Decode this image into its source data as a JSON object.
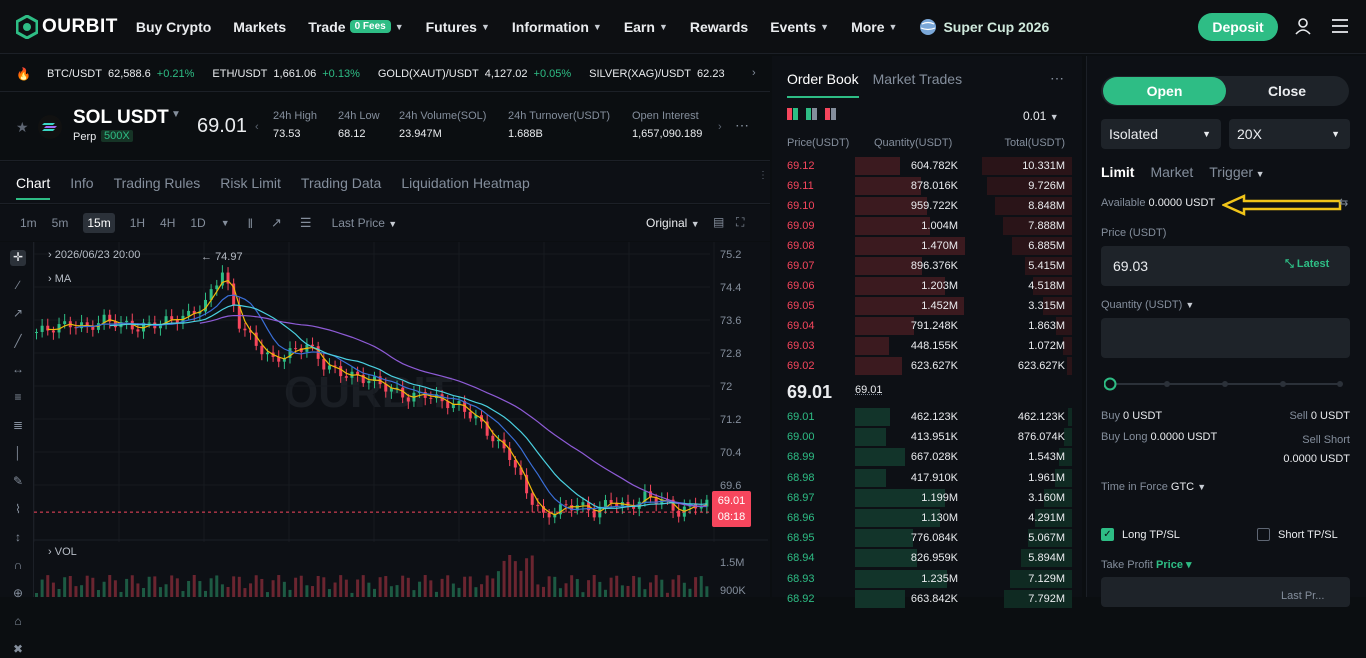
{
  "nav": {
    "logo_text": "OURBIT",
    "items": [
      {
        "label": "Buy Crypto",
        "dropdown": false
      },
      {
        "label": "Markets",
        "dropdown": false
      },
      {
        "label": "Trade",
        "badge": "0 Fees",
        "dropdown": true
      },
      {
        "label": "Futures",
        "dropdown": true
      },
      {
        "label": "Information",
        "dropdown": true
      },
      {
        "label": "Earn",
        "dropdown": true
      },
      {
        "label": "Rewards",
        "dropdown": false
      },
      {
        "label": "Events",
        "dropdown": true
      },
      {
        "label": "More",
        "dropdown": true
      }
    ],
    "super_cup": "Super Cup 2026",
    "deposit_label": "Deposit",
    "icons": [
      "user-icon",
      "menu-icon"
    ]
  },
  "ticker": [
    {
      "symbol": "BTC/USDT",
      "price": "62,588.6",
      "change": "+0.21%"
    },
    {
      "symbol": "ETH/USDT",
      "price": "1,661.06",
      "change": "+0.13%"
    },
    {
      "symbol": "GOLD(XAUT)/USDT",
      "price": "4,127.02",
      "change": "+0.05%"
    },
    {
      "symbol": "SILVER(XAG)/USDT",
      "price": "62.23",
      "change": ""
    }
  ],
  "symbol": {
    "name": "SOL USDT",
    "type": "Perp",
    "leverage": "500X",
    "price": "69.01",
    "stats": [
      {
        "label": "24h High",
        "value": "73.53"
      },
      {
        "label": "24h Low",
        "value": "68.12"
      },
      {
        "label": "24h Volume(SOL)",
        "value": "23.947M"
      },
      {
        "label": "24h Turnover(USDT)",
        "value": "1.688B"
      },
      {
        "label": "Open Interest",
        "value": "1,657,090.189"
      }
    ]
  },
  "chart_tabs": [
    "Chart",
    "Info",
    "Trading Rules",
    "Risk Limit",
    "Trading Data",
    "Liquidation Heatmap"
  ],
  "intervals": [
    "1m",
    "5m",
    "15m",
    "1H",
    "4H",
    "1D"
  ],
  "active_interval": "15m",
  "price_type": "Last Price",
  "chart_mode": "Original",
  "chart": {
    "crosshair_time": "2026/06/23 20:00",
    "ma_label": "MA",
    "vol_label": "VOL",
    "high_marker": "74.97",
    "y_ticks": [
      "75.2",
      "74.4",
      "73.6",
      "72.8",
      "72",
      "71.2",
      "70.4",
      "69.6"
    ],
    "vol_ticks": [
      "1.5M",
      "900K"
    ],
    "last_price_tag": "69.01",
    "countdown": "08:18",
    "colors": {
      "up": "#2ebd85",
      "down": "#f6465d",
      "ma_fast": "#f0b90b",
      "ma_mid": "#4ad0e0",
      "ma_slow": "#8e5bd6",
      "ma_blue": "#3a6fd8"
    }
  },
  "chart_data": {
    "type": "line",
    "interval": "15m",
    "series": [
      {
        "values": [
          73.4,
          73.5,
          73.6,
          73.5,
          73.7,
          73.6,
          73.5,
          73.6,
          73.7,
          73.8,
          74.1,
          74.9,
          73.6,
          73.1,
          72.7,
          72.9,
          73.1,
          72.6,
          72.4,
          72.3,
          72.2,
          72.0,
          71.8,
          71.9,
          71.7,
          71.6,
          71.3,
          70.8,
          70.4,
          69.5,
          68.9,
          69.1,
          69.2,
          69.0,
          69.3,
          69.1,
          69.4,
          69.3,
          69.0,
          69.2
        ]
      }
    ],
    "ylim": [
      68.6,
      75.3
    ]
  },
  "order_book": {
    "tabs": [
      "Order Book",
      "Market Trades"
    ],
    "precision": "0.01",
    "headers": [
      "Price(USDT)",
      "Quantity(USDT)",
      "Total(USDT)"
    ],
    "asks": [
      {
        "price": "69.12",
        "qty": "604.782K",
        "total": "10.331M"
      },
      {
        "price": "69.11",
        "qty": "878.016K",
        "total": "9.726M"
      },
      {
        "price": "69.10",
        "qty": "959.722K",
        "total": "8.848M"
      },
      {
        "price": "69.09",
        "qty": "1.004M",
        "total": "7.888M"
      },
      {
        "price": "69.08",
        "qty": "1.470M",
        "total": "6.885M"
      },
      {
        "price": "69.07",
        "qty": "896.376K",
        "total": "5.415M"
      },
      {
        "price": "69.06",
        "qty": "1.203M",
        "total": "4.518M"
      },
      {
        "price": "69.05",
        "qty": "1.452M",
        "total": "3.315M"
      },
      {
        "price": "69.04",
        "qty": "791.248K",
        "total": "1.863M"
      },
      {
        "price": "69.03",
        "qty": "448.155K",
        "total": "1.072M"
      },
      {
        "price": "69.02",
        "qty": "623.627K",
        "total": "623.627K"
      }
    ],
    "mid_price": "69.01",
    "mid_ref": "69.01",
    "bids": [
      {
        "price": "69.01",
        "qty": "462.123K",
        "total": "462.123K"
      },
      {
        "price": "69.00",
        "qty": "413.951K",
        "total": "876.074K"
      },
      {
        "price": "68.99",
        "qty": "667.028K",
        "total": "1.543M"
      },
      {
        "price": "68.98",
        "qty": "417.910K",
        "total": "1.961M"
      },
      {
        "price": "68.97",
        "qty": "1.199M",
        "total": "3.160M"
      },
      {
        "price": "68.96",
        "qty": "1.130M",
        "total": "4.291M"
      },
      {
        "price": "68.95",
        "qty": "776.084K",
        "total": "5.067M"
      },
      {
        "price": "68.94",
        "qty": "826.959K",
        "total": "5.894M"
      },
      {
        "price": "68.93",
        "qty": "1.235M",
        "total": "7.129M"
      },
      {
        "price": "68.92",
        "qty": "663.842K",
        "total": "7.792M"
      }
    ],
    "ask_color": "#f6465d",
    "bid_color": "#2ebd85"
  },
  "trade": {
    "open_label": "Open",
    "close_label": "Close",
    "margin_mode": "Isolated",
    "leverage": "20X",
    "order_types": [
      "Limit",
      "Market",
      "Trigger"
    ],
    "available_label": "Available",
    "available_value": "0.0000 USDT",
    "price_label": "Price (USDT)",
    "price_value": "69.03",
    "latest_label": "Latest",
    "qty_label": "Quantity (USDT)",
    "buy_label": "Buy",
    "buy_value": "0 USDT",
    "sell_label": "Sell",
    "sell_value": "0 USDT",
    "buy_long_label": "Buy Long",
    "buy_long_value": "0.0000 USDT",
    "sell_short_label": "Sell Short",
    "sell_short_value": "0.0000 USDT",
    "tif_label": "Time in Force",
    "tif_value": "GTC",
    "long_tpsl": "Long TP/SL",
    "long_tpsl_checked": true,
    "short_tpsl": "Short TP/SL",
    "short_tpsl_checked": false,
    "take_profit_label": "Take Profit",
    "take_profit_type": "Price",
    "tp_placeholder": "Last Pr..."
  }
}
